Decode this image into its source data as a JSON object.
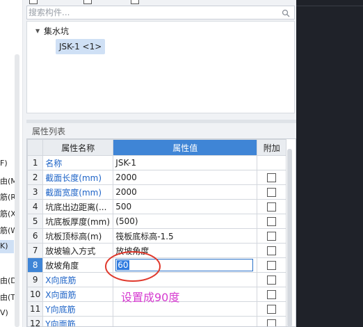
{
  "search": {
    "placeholder": "搜索构件..."
  },
  "left_strip": {
    "labels": [
      "F)",
      "由(M",
      "筋(R)",
      "筋(X)",
      "筋(W",
      "K)",
      "由(D)",
      "由(T)",
      "V)"
    ]
  },
  "tree": {
    "parent_label": "集水坑",
    "child_label": "JSK-1 <1>"
  },
  "properties": {
    "section_title": "属性列表",
    "columns": [
      "属性名称",
      "属性值",
      "附加"
    ],
    "rows": [
      {
        "num": "1",
        "name": "名称",
        "value": "JSK-1",
        "blue": true,
        "checkbox": false
      },
      {
        "num": "2",
        "name": "截面长度(mm)",
        "value": "2000",
        "blue": true,
        "checkbox": true
      },
      {
        "num": "3",
        "name": "截面宽度(mm)",
        "value": "2000",
        "blue": true,
        "checkbox": true
      },
      {
        "num": "4",
        "name": "坑底出边距离(...",
        "value": "500",
        "blue": false,
        "checkbox": true
      },
      {
        "num": "5",
        "name": "坑底板厚度(mm)",
        "value": "(500)",
        "blue": false,
        "checkbox": true
      },
      {
        "num": "6",
        "name": "坑板顶标高(m)",
        "value": "筏板底标高-1.5",
        "blue": false,
        "checkbox": true
      },
      {
        "num": "7",
        "name": "放坡输入方式",
        "value": "放坡角度",
        "blue": false,
        "checkbox": true
      },
      {
        "num": "8",
        "name": "放坡角度",
        "value": "60",
        "blue": false,
        "checkbox": true,
        "editing": true
      },
      {
        "num": "9",
        "name": "X向底筋",
        "value": "",
        "blue": true,
        "checkbox": true
      },
      {
        "num": "10",
        "name": "X向面筋",
        "value": "",
        "blue": true,
        "checkbox": true
      },
      {
        "num": "11",
        "name": "Y向底筋",
        "value": "",
        "blue": true,
        "checkbox": true
      },
      {
        "num": "12",
        "name": "Y向面筋",
        "value": "",
        "blue": true,
        "checkbox": true
      }
    ]
  },
  "annotation": {
    "text": "设置成90度",
    "color": "#d63ad0"
  },
  "colors": {
    "accent": "#3f85d6",
    "link_blue": "#1d63c7",
    "panel_bg": "#f0f2f5",
    "dark_bg": "#1f2229"
  }
}
